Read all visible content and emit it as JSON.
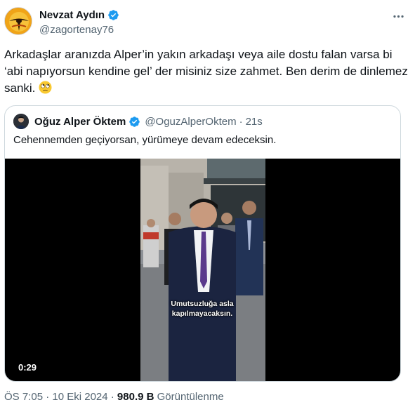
{
  "author": {
    "display_name": "Nevzat Aydın",
    "handle": "@zagortenay76",
    "avatar_icon": "avatar-image",
    "verified_icon": "verified-badge-icon",
    "verified_color": "#1d9bf0"
  },
  "more_icon": "more-dots-icon",
  "tweet": {
    "text": "Arkadaşlar aranızda Alper’in yakın arkadaşı veya aile dostu falan varsa bi ‘abi napıyorsun kendine gel’ der misiniz size zahmet. Ben derim de dinlemez sanki. ",
    "emoji_icon": "rolling-eyes-emoji-icon"
  },
  "quote": {
    "display_name": "Oğuz Alper Öktem",
    "handle": "@OguzAlperOktem",
    "separator": "·",
    "time": "21s",
    "text": "Cehennemden geçiyorsan, yürümeye devam edeceksin.",
    "video": {
      "subtitle_line1": "Umutsuzluğa asla",
      "subtitle_line2": "kapılmayacaksın.",
      "duration": "0:29"
    }
  },
  "meta": {
    "time_date": "ÖS 7:05 · 10 Eki 2024 · ",
    "views": "980,9 B",
    "views_label": " Görüntülenme"
  },
  "colors": {
    "text_primary": "#0f1419",
    "text_secondary": "#536471",
    "border": "#cfd9de",
    "accent": "#1d9bf0"
  }
}
